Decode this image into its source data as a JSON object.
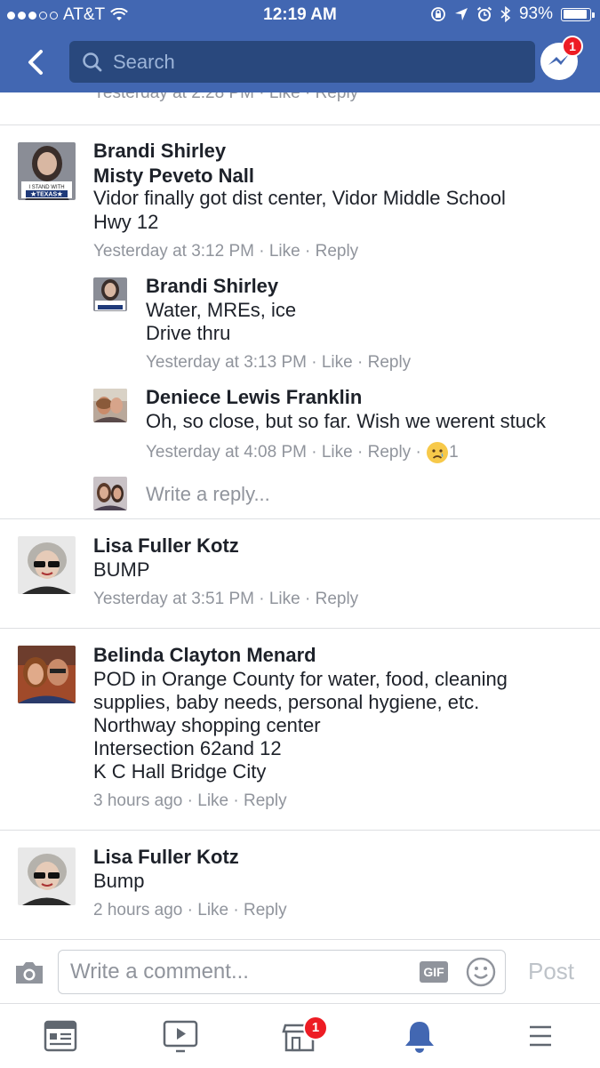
{
  "status_bar": {
    "carrier": "AT&T",
    "time": "12:19 AM",
    "battery": "93%",
    "battery_level": 0.93
  },
  "header": {
    "search_placeholder": "Search",
    "messenger_badge": "1"
  },
  "partial_comment": {
    "meta": "Yesterday at 2:28 PM · Like · Reply"
  },
  "comments": [
    {
      "author": "Brandi Shirley",
      "avatar_caption": "I STAND WITH TEXAS",
      "lines": [
        "Misty Peveto Nall",
        "Vidor finally got dist center, Vidor Middle School",
        "Hwy 12"
      ],
      "time": "Yesterday at 3:12 PM",
      "like": "Like",
      "reply": "Reply",
      "replies": [
        {
          "author": "Brandi Shirley",
          "avatar_caption": "I STAND WITH TEXAS",
          "lines": [
            "Water, MREs, ice",
            "Drive thru"
          ],
          "time": "Yesterday at 3:13 PM",
          "like": "Like",
          "reply": "Reply"
        },
        {
          "author": "Deniece Lewis Franklin",
          "lines": [
            "Oh, so close, but so far. Wish we werent stuck"
          ],
          "time": "Yesterday at 4:08 PM",
          "like": "Like",
          "reply": "Reply",
          "reaction_count": "1"
        }
      ],
      "reply_placeholder": "Write a reply..."
    },
    {
      "author": "Lisa Fuller Kotz",
      "lines": [
        "BUMP"
      ],
      "time": "Yesterday at 3:51 PM",
      "like": "Like",
      "reply": "Reply"
    },
    {
      "author": "Belinda Clayton Menard",
      "lines": [
        "POD in Orange County for water, food, cleaning",
        "supplies, baby needs, personal hygiene, etc.",
        "Northway shopping center",
        "Intersection 62and 12",
        "K C Hall Bridge City"
      ],
      "time": "3 hours ago",
      "like": "Like",
      "reply": "Reply"
    },
    {
      "author": "Lisa Fuller Kotz",
      "lines": [
        "Bump"
      ],
      "time": "2 hours ago",
      "like": "Like",
      "reply": "Reply"
    }
  ],
  "composer": {
    "placeholder": "Write a comment...",
    "gif_label": "GIF",
    "post_label": "Post"
  },
  "tab_bar": {
    "items": [
      "news-feed",
      "watch",
      "marketplace",
      "notifications",
      "menu"
    ],
    "marketplace_badge": "1",
    "active": "notifications"
  },
  "colors": {
    "brand": "#4267b2",
    "search_bg": "#29487d",
    "meta_text": "#90949c",
    "badge": "#ed1c24"
  }
}
